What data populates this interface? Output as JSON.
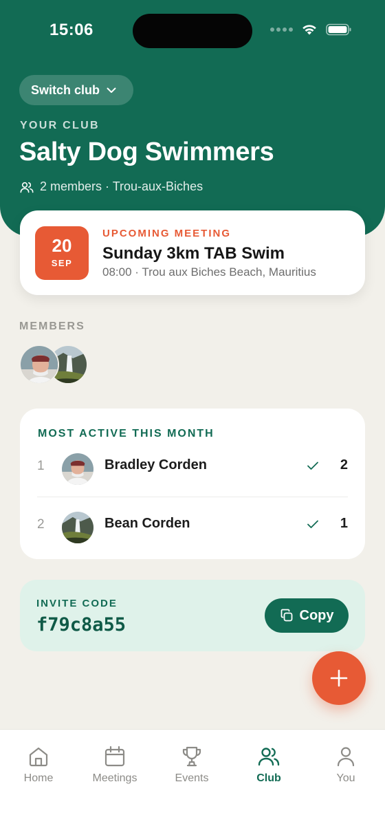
{
  "status_bar": {
    "time": "15:06"
  },
  "header": {
    "switch_club_label": "Switch club",
    "section_label": "YOUR CLUB",
    "club_name": "Salty Dog Swimmers",
    "club_meta": "2 members · Trou-aux-Biches"
  },
  "upcoming": {
    "day": "20",
    "month": "SEP",
    "label": "UPCOMING MEETING",
    "title": "Sunday 3km TAB Swim",
    "details": "08:00 · Trou aux Biches Beach, Mauritius"
  },
  "members": {
    "label": "MEMBERS"
  },
  "most_active": {
    "title": "MOST ACTIVE THIS MONTH",
    "rows": [
      {
        "rank": "1",
        "name": "Bradley Corden",
        "count": "2"
      },
      {
        "rank": "2",
        "name": "Bean Corden",
        "count": "1"
      }
    ]
  },
  "invite": {
    "label": "INVITE CODE",
    "code": "f79c8a55",
    "copy_label": "Copy"
  },
  "tabs": [
    {
      "label": "Home",
      "icon": "home-icon"
    },
    {
      "label": "Meetings",
      "icon": "calendar-icon"
    },
    {
      "label": "Events",
      "icon": "trophy-icon"
    },
    {
      "label": "Club",
      "icon": "people-icon"
    },
    {
      "label": "You",
      "icon": "person-icon"
    }
  ],
  "colors": {
    "brand_green": "#126b54",
    "accent_orange": "#e75a35",
    "background": "#f2f0ea",
    "invite_bg": "#dff2ea"
  }
}
